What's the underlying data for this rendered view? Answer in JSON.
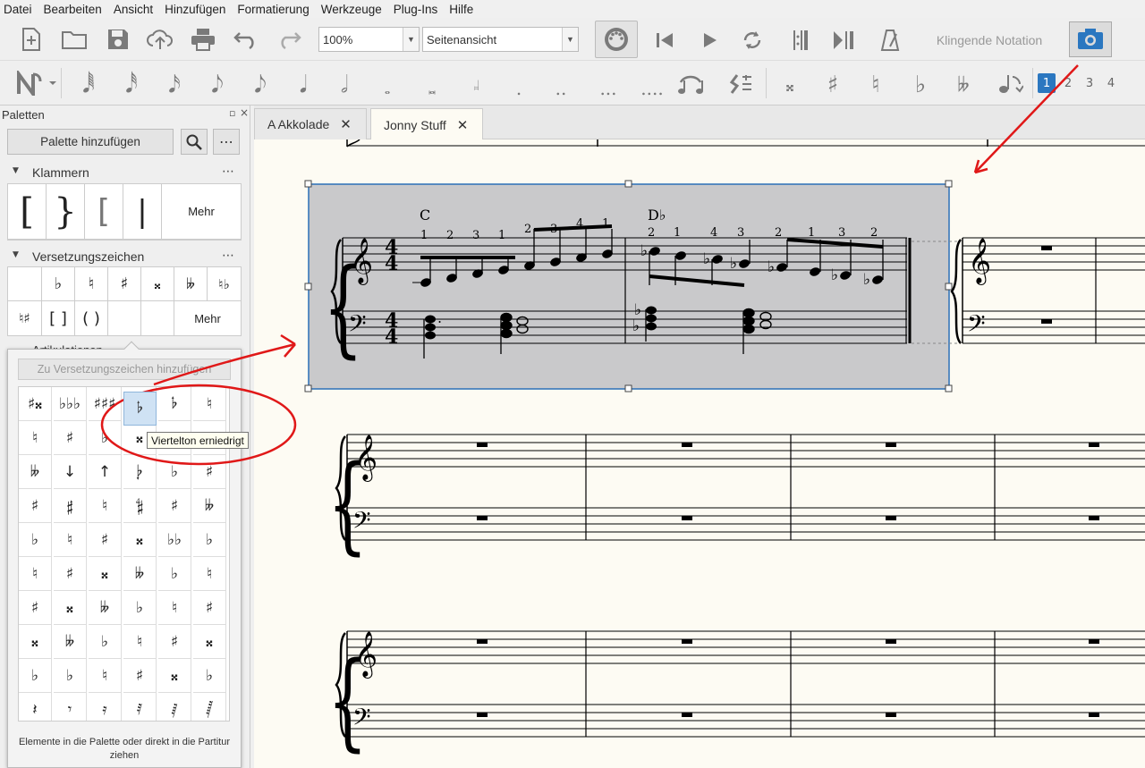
{
  "menu": [
    "Datei",
    "Bearbeiten",
    "Ansicht",
    "Hinzufügen",
    "Formatierung",
    "Werkzeuge",
    "Plug-Ins",
    "Hilfe"
  ],
  "toolbar": {
    "zoom_value": "100%",
    "view_mode": "Seitenansicht",
    "concert_pitch_label": "Klingende Notation"
  },
  "note_toolbar": {
    "pages": [
      "1",
      "2",
      "3",
      "4"
    ],
    "active_page": "1",
    "accidentals": [
      "𝄪",
      "♯",
      "♮",
      "♭",
      "𝄫"
    ]
  },
  "palette": {
    "title": "Paletten",
    "add_button": "Palette hinzufügen",
    "sections": [
      {
        "name": "Klammern",
        "more": "Mehr"
      },
      {
        "name": "Versetzungszeichen",
        "more": "Mehr",
        "row1": [
          "♭",
          "♮",
          "♯",
          "𝄪",
          "𝄫",
          "♮♭"
        ],
        "row2": [
          "♮♯",
          "[ ]",
          "( )"
        ]
      },
      {
        "name": "Artikulationen"
      }
    ],
    "popup_search_placeholder": "Zu Versetzungszeichen hinzufügen",
    "popup_hint": "Elemente in die Palette oder direkt in die Partitur ziehen",
    "tooltip": "Viertelton erniedrigt",
    "grid": [
      [
        "♯𝄪",
        "♭♭♭",
        "♯♯♯",
        "𝄬",
        "𝄬",
        "♮"
      ],
      [
        "♮",
        "♯",
        "♭",
        "𝄪",
        "",
        ""
      ],
      [
        "𝄫",
        "↓",
        "↑",
        "𝄭",
        "♭",
        "♯"
      ],
      [
        "♯",
        "𝄰",
        "♮",
        "𝄲",
        "♯",
        "𝄫"
      ],
      [
        "♭",
        "♮",
        "♯",
        "𝄪",
        "♭♭",
        "♭"
      ],
      [
        "♮",
        "♯",
        "𝄪",
        "𝄫",
        "♭",
        "♮"
      ],
      [
        "♯",
        "𝄪",
        "𝄫",
        "♭",
        "♮",
        "♯"
      ],
      [
        "𝄪",
        "𝄫",
        "♭",
        "♮",
        "♯",
        "𝄪"
      ],
      [
        "♭",
        "♭",
        "♮",
        "♯",
        "𝄪",
        "♭"
      ],
      [
        "𝄽",
        "𝄾",
        "𝄿",
        "𝅀",
        "𝅁",
        "𝅂"
      ]
    ]
  },
  "tabs": [
    {
      "label": "A Akkolade",
      "active": false
    },
    {
      "label": "Jonny Stuff",
      "active": true
    }
  ],
  "score": {
    "chord_symbols": [
      "C",
      "D♭"
    ],
    "fingering_m1": [
      "1",
      "2",
      "3",
      "1",
      "2",
      "3",
      "4",
      "1"
    ],
    "fingering_m2": [
      "2",
      "1",
      "4",
      "3",
      "2",
      "1",
      "3",
      "2"
    ],
    "time_signature": "4/4"
  }
}
